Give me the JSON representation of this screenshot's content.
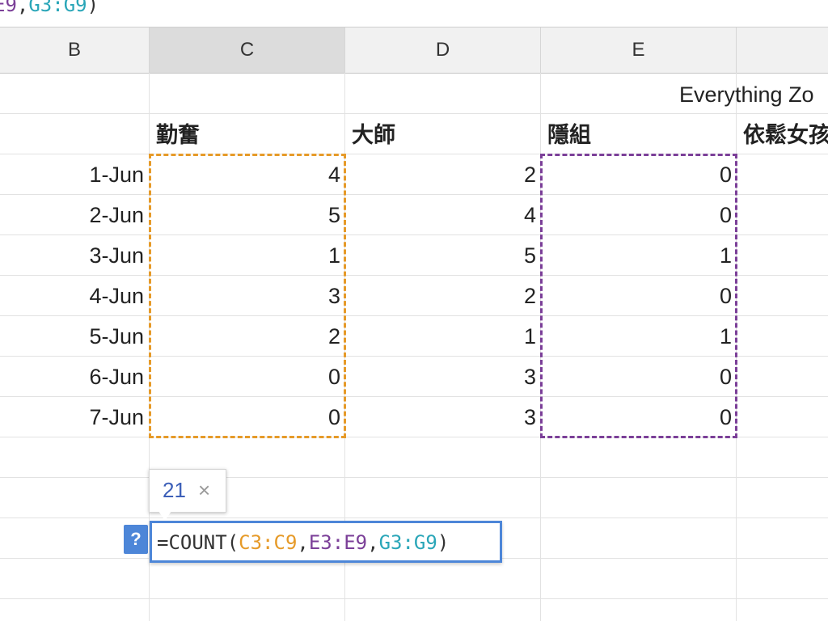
{
  "formula_bar": {
    "visible_parts": [
      {
        "text": "E9",
        "color": "#7b3f98"
      },
      {
        "text": ",",
        "color": "#333333"
      },
      {
        "text": "G3:G9",
        "color": "#2aa6b8"
      },
      {
        "text": ")",
        "color": "#333333"
      }
    ]
  },
  "columns": [
    "B",
    "C",
    "D",
    "E",
    ""
  ],
  "active_column": "C",
  "sheet": {
    "title_fragment": "Everything Zo",
    "headers": {
      "c": "勤奮",
      "d": "大師",
      "e": "隱組",
      "f": "依鬆女孩"
    },
    "rows": [
      {
        "date": "1-Jun",
        "c": "4",
        "d": "2",
        "e": "0"
      },
      {
        "date": "2-Jun",
        "c": "5",
        "d": "4",
        "e": "0"
      },
      {
        "date": "3-Jun",
        "c": "1",
        "d": "5",
        "e": "1"
      },
      {
        "date": "4-Jun",
        "c": "3",
        "d": "2",
        "e": "0"
      },
      {
        "date": "5-Jun",
        "c": "2",
        "d": "1",
        "e": "1"
      },
      {
        "date": "6-Jun",
        "c": "0",
        "d": "3",
        "e": "0"
      },
      {
        "date": "7-Jun",
        "c": "0",
        "d": "3",
        "e": "0"
      }
    ]
  },
  "tooltip": {
    "value": "21",
    "close_glyph": "×"
  },
  "help_button": {
    "label": "?"
  },
  "cell_editor": {
    "parts": [
      {
        "text": "=COUNT(",
        "color": "#333333"
      },
      {
        "text": "C3:C9",
        "color": "#e69a28"
      },
      {
        "text": ",",
        "color": "#333333"
      },
      {
        "text": "E3:E9",
        "color": "#7b3f98"
      },
      {
        "text": ",",
        "color": "#333333"
      },
      {
        "text": "G3:G9",
        "color": "#2aa6b8"
      },
      {
        "text": ")",
        "color": "#333333"
      }
    ]
  },
  "colors": {
    "range_c": "#e69a28",
    "range_e": "#7b3f98",
    "range_g": "#2aa6b8",
    "editor_border": "#4d86d8",
    "tooltip_value": "#3c5fb8"
  },
  "icons": {
    "close": "close-icon",
    "help": "help-icon"
  }
}
